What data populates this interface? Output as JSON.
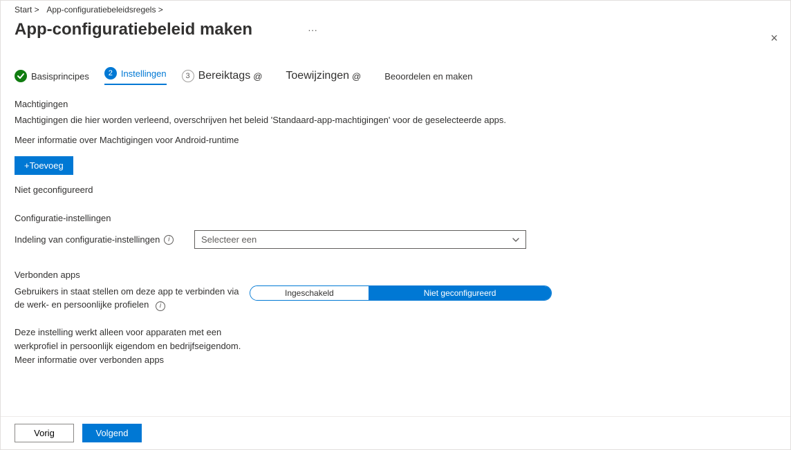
{
  "breadcrumbs": {
    "home": "Start >",
    "policies": "App-configuratiebeleidsregels >"
  },
  "title": "App-configuratiebeleid maken",
  "ellipsis": "···",
  "close": "×",
  "steps": {
    "basics": "Basisprincipes",
    "settings_num": "2",
    "settings": "Instellingen",
    "scopetags_num": "3",
    "scopetags": "Bereiktags",
    "assignments": "Toewijzingen",
    "review": "Beoordelen en maken",
    "at": "@"
  },
  "permissions": {
    "title": "Machtigingen",
    "desc": "Machtigingen die hier worden verleend, overschrijven het beleid 'Standaard-app-machtigingen' voor de geselecteerde apps.",
    "learnmore": "Meer informatie over Machtigingen voor Android-runtime",
    "add": "+Toevoeg",
    "not_configured": "Niet geconfigureerd"
  },
  "config": {
    "title": "Configuratie-instellingen",
    "format_label": "Indeling van configuratie-instellingen",
    "select_placeholder": "Selecteer een"
  },
  "connected": {
    "title": "Verbonden apps",
    "label": "Gebruikers in staat stellen om deze app te verbinden via de werk- en persoonlijke profielen",
    "enabled": "Ingeschakeld",
    "not_configured": "Niet geconfigureerd",
    "note": "Deze instelling werkt alleen voor apparaten met een werkprofiel in persoonlijk eigendom en bedrijfseigendom. Meer informatie over verbonden apps"
  },
  "footer": {
    "prev": "Vorig",
    "next": "Volgend"
  }
}
